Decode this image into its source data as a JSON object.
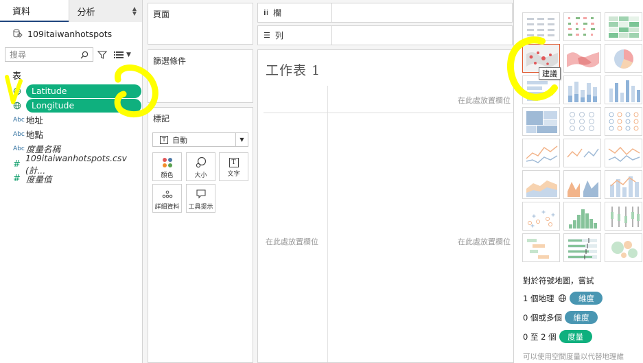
{
  "data_pane": {
    "tabs": [
      {
        "label": "資料",
        "active": true
      },
      {
        "label": "分析",
        "active": false
      }
    ],
    "datasource_name": "109itaiwanhotspots",
    "search_placeholder": "搜尋",
    "section_label": "表",
    "fields": [
      {
        "name": "Latitude",
        "type": "geo",
        "icon_glyph": "⊕",
        "highlighted": true
      },
      {
        "name": "Longitude",
        "type": "geo",
        "icon_glyph": "⊕",
        "highlighted": true
      },
      {
        "name": "地址",
        "type": "string",
        "icon_glyph": "Abc",
        "highlighted": false
      },
      {
        "name": "地點",
        "type": "string",
        "icon_glyph": "Abc",
        "highlighted": false
      },
      {
        "name": "度量名稱",
        "type": "string",
        "icon_glyph": "Abc",
        "highlighted": false,
        "italic": true
      },
      {
        "name": "109itaiwanhotspots.csv (計...",
        "type": "measure",
        "icon_glyph": "#",
        "highlighted": false,
        "italic": true
      },
      {
        "name": "度量值",
        "type": "measure",
        "icon_glyph": "#",
        "highlighted": false,
        "italic": true
      }
    ]
  },
  "shelves": {
    "pages_title": "頁面",
    "filters_title": "篩選條件",
    "marks_title": "標記",
    "marks_type_glyph": "T",
    "marks_type": "自動",
    "mark_buttons": [
      "顏色",
      "大小",
      "文字",
      "詳細資料",
      "工具提示"
    ],
    "text_button_glyph": "T",
    "columns_label": "欄",
    "rows_label": "列"
  },
  "worksheet": {
    "title": "工作表 1",
    "drop_hint": "在此處放置欄位"
  },
  "show_me": {
    "tooltip": "建議",
    "requirement_title": "對於符號地圖，嘗試",
    "requirements": [
      {
        "text": "1 個地理",
        "badge": "維度",
        "kind": "dimension",
        "geo_icon": true
      },
      {
        "text": "0 個或多個",
        "badge": "維度",
        "kind": "dimension",
        "geo_icon": false
      },
      {
        "text": "0 至 2 個",
        "badge": "度量",
        "kind": "measure",
        "geo_icon": false
      }
    ],
    "footer": "可以使用空間度量以代替地理維",
    "thumbnails": [
      "text-table",
      "heat-map",
      "highlight-table",
      "symbol-map",
      "filled-map",
      "pie-chart",
      "horizontal-bars",
      "stacked-bars",
      "side-by-side-bars",
      "treemap",
      "circle-views",
      "side-by-side-circles",
      "continuous-lines",
      "discrete-lines",
      "dual-lines",
      "area-continuous",
      "area-discrete",
      "dual-combination",
      "scatter-plot",
      "histogram",
      "box-whisker",
      "gantt-chart",
      "bullet-graph",
      "packed-bubbles"
    ]
  },
  "colors": {
    "measure_green": "#0fb07e",
    "dimension_blue": "#4996b2",
    "selection_orange": "#e05a32",
    "annotation_yellow": "#ffff00"
  }
}
